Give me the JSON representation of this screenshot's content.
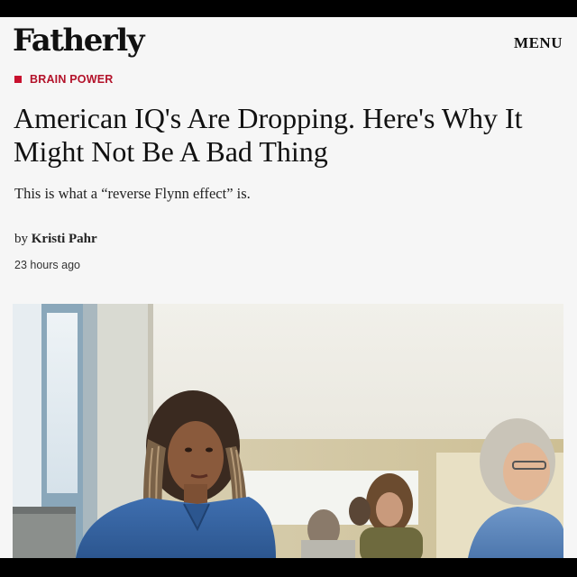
{
  "header": {
    "logo": "Fatherly",
    "menu_label": "MENU"
  },
  "article": {
    "category": "BRAIN POWER",
    "headline": "American IQ's Are Dropping. Here's Why It Might Not Be A Bad Thing",
    "dek": "This is what a “reverse Flynn effect” is.",
    "byline_prefix": "by",
    "author": "Kristi Pahr",
    "timestamp": "23 hours ago"
  },
  "colors": {
    "accent": "#c8102e",
    "background": "#f6f6f6"
  },
  "hero_image": {
    "subject": "classroom-photo"
  }
}
